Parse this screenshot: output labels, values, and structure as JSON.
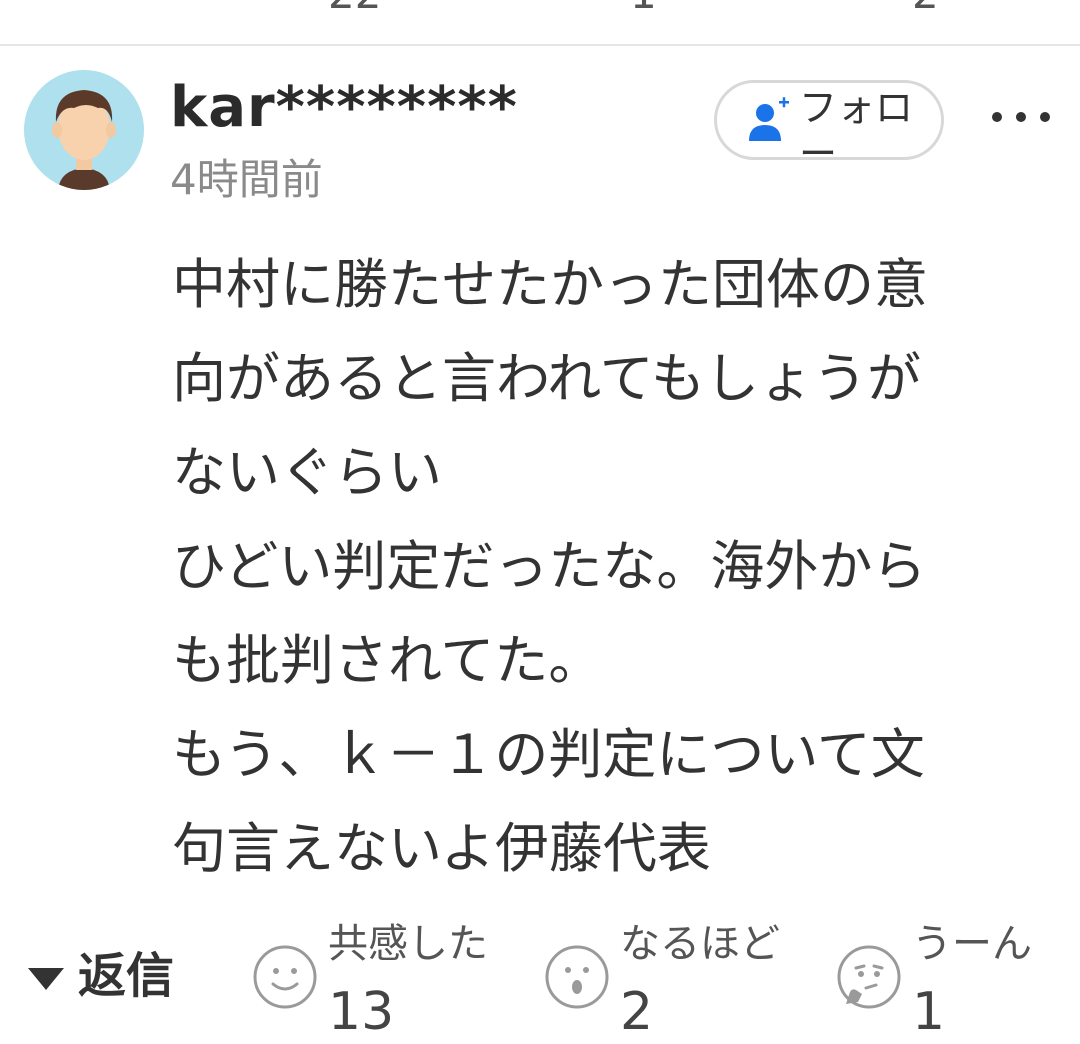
{
  "top_bar": {
    "counts": [
      "22",
      "1",
      "2"
    ]
  },
  "comment": {
    "user": {
      "name": "kar********"
    },
    "time": "4時間前",
    "follow_label": "フォロー",
    "text": "中村に勝たせたかった団体の意\n向があると言われてもしょうが\nないぐらい\nひどい判定だったな。海外から\nも批判されてた。\nもう、ｋ－１の判定について文\n句言えないよ伊藤代表"
  },
  "actions": {
    "reply_label": "返信",
    "reactions": [
      {
        "label": "共感した",
        "count": "13",
        "icon": "smile-face-icon"
      },
      {
        "label": "なるほど",
        "count": "2",
        "icon": "surprised-face-icon"
      },
      {
        "label": "うーん",
        "count": "1",
        "icon": "thinking-face-icon"
      }
    ]
  },
  "colors": {
    "text": "#333333",
    "muted": "#8a8a8a",
    "accent": "#1a73e8",
    "avatar_bg": "#aee0ee"
  }
}
